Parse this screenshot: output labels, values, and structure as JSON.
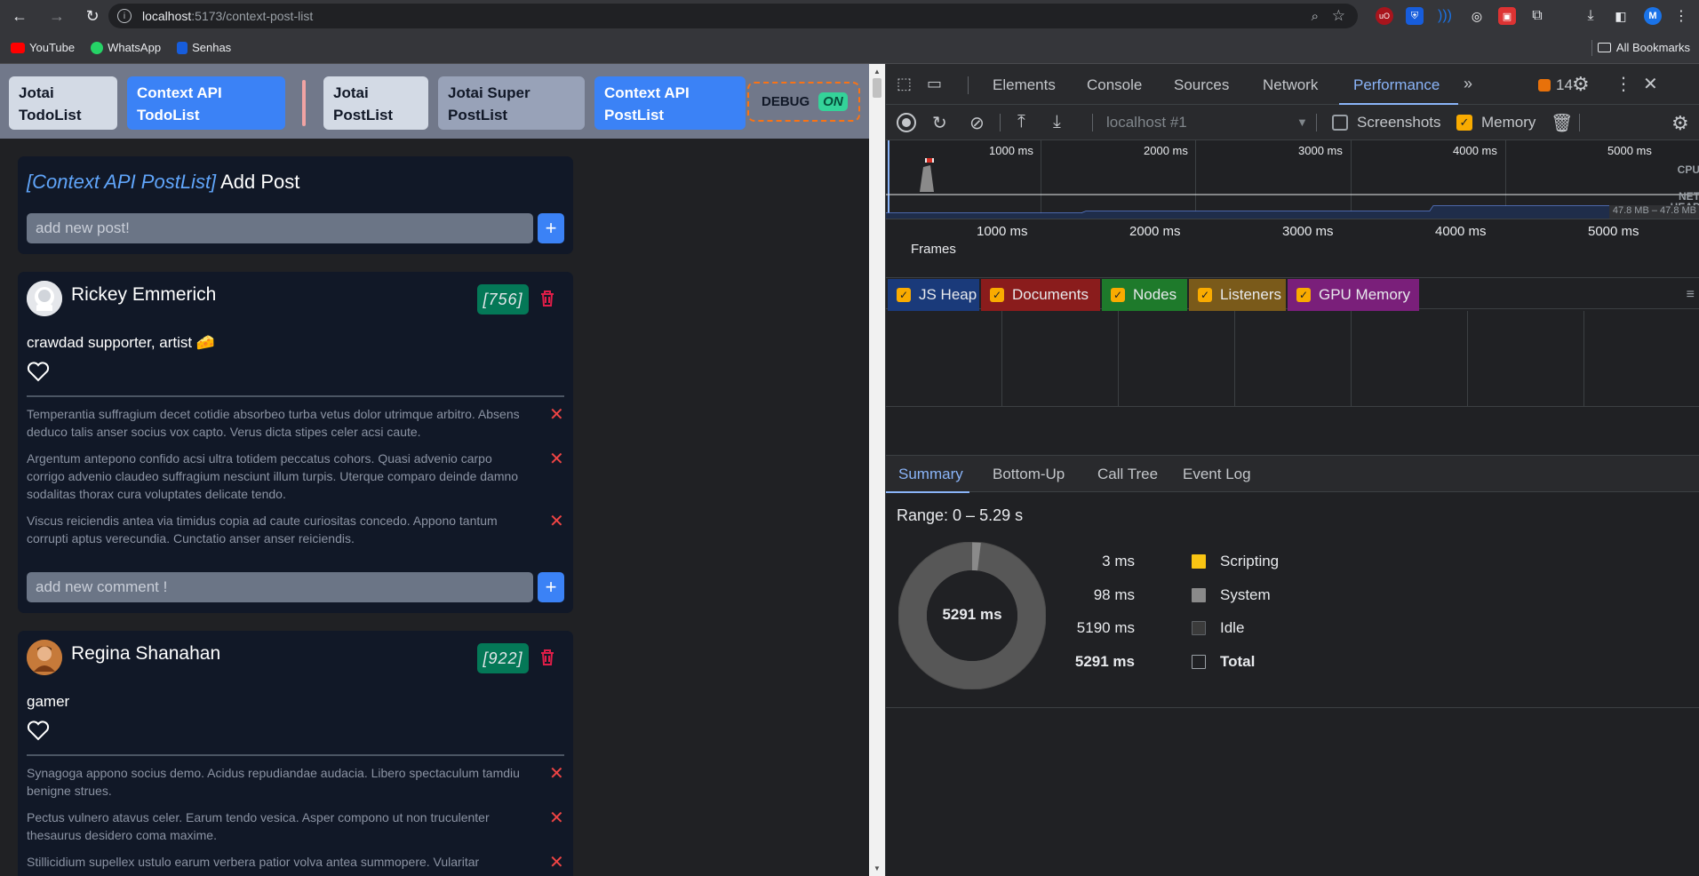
{
  "browser": {
    "url_host": "localhost",
    "url_path": ":5173/context-post-list",
    "bookmarks": [
      "YouTube",
      "WhatsApp",
      "Senhas"
    ],
    "all_bookmarks": "All Bookmarks",
    "avatar_letter": "M"
  },
  "app": {
    "nav_tabs": [
      {
        "label": "Jotai TodoList"
      },
      {
        "label": "Context API TodoList"
      },
      {
        "label": "Jotai PostList"
      },
      {
        "label": "Jotai Super PostList"
      },
      {
        "label": "Context API PostList"
      }
    ],
    "debug": {
      "label": "DEBUG",
      "state": "ON"
    },
    "add_post": {
      "context_label": "[Context API PostList]",
      "title": "Add Post",
      "placeholder": "add new post!"
    },
    "posts": [
      {
        "author": "Rickey Emmerich",
        "id_badge": "[756]",
        "bio": "crawdad supporter, artist 🧀",
        "comments": [
          "Temperantia suffragium decet cotidie absorbeo turba vetus dolor utrimque arbitro. Absens deduco talis anser socius vox capto. Verus dicta stipes celer acsi caute.",
          "Argentum antepono confido acsi ultra totidem peccatus cohors. Quasi advenio carpo corrigo advenio claudeo suffragium nesciunt illum turpis. Uterque comparo deinde damno sodalitas thorax cura voluptates delicate tendo.",
          "Viscus reiciendis antea via timidus copia ad caute curiositas concedo. Appono tantum corrupti aptus verecundia. Cunctatio anser anser reiciendis."
        ],
        "comment_placeholder": "add new comment !"
      },
      {
        "author": "Regina Shanahan",
        "id_badge": "[922]",
        "bio": "gamer",
        "comments": [
          "Synagoga appono socius demo. Acidus repudiandae audacia. Libero spectaculum tamdiu benigne strues.",
          "Pectus vulnero atavus celer. Earum tendo vesica. Asper compono ut non truculenter thesaurus desidero coma maxime.",
          "Stillicidium supellex ustulo earum verbera patior volva antea summopere. Vularitar"
        ]
      }
    ]
  },
  "devtools": {
    "tabs": [
      "Elements",
      "Console",
      "Sources",
      "Network",
      "Performance"
    ],
    "active_tab": "Performance",
    "issues_count": "14",
    "target": "localhost #1",
    "screenshots_label": "Screenshots",
    "memory_label": "Memory",
    "overview_ticks": [
      "1000 ms",
      "2000 ms",
      "3000 ms",
      "4000 ms",
      "5000 ms"
    ],
    "overview_labels": {
      "cpu": "CPU",
      "net": "NET",
      "heap": "HEAP"
    },
    "heap_range": "47.8 MB – 47.8 MB",
    "ruler_ticks": [
      "1000 ms",
      "2000 ms",
      "3000 ms",
      "4000 ms",
      "5000 ms"
    ],
    "frames_label": "Frames",
    "counters": [
      {
        "label": "JS Heap",
        "color": "#1a3a7a"
      },
      {
        "label": "Documents",
        "color": "#8a1c1c"
      },
      {
        "label": "Nodes",
        "color": "#1e7a2b"
      },
      {
        "label": "Listeners",
        "color": "#7a5a1a"
      },
      {
        "label": "GPU Memory",
        "color": "#7a1f7a"
      }
    ],
    "bottom_tabs": [
      "Summary",
      "Bottom-Up",
      "Call Tree",
      "Event Log"
    ],
    "range": "Range: 0 – 5.29 s",
    "donut_total": "5291 ms",
    "summary": [
      {
        "value": "3 ms",
        "label": "Scripting",
        "color": "#f9c513"
      },
      {
        "value": "98 ms",
        "label": "System",
        "color": "#8a8a8a"
      },
      {
        "value": "5190 ms",
        "label": "Idle",
        "color": "#3b3b3b"
      },
      {
        "value": "5291 ms",
        "label": "Total",
        "color": "#202124"
      }
    ]
  }
}
